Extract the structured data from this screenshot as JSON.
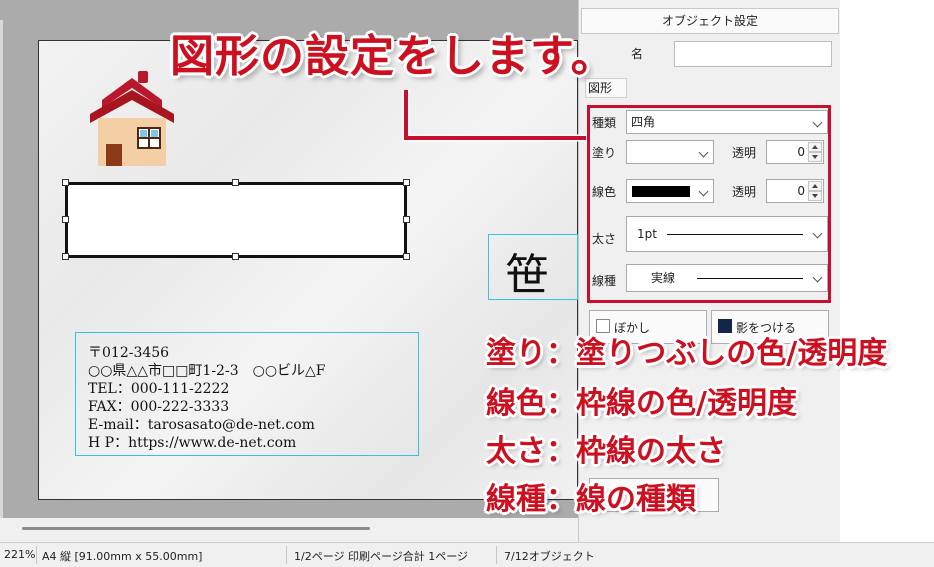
{
  "annotations": {
    "title": "図形の設定をします。",
    "lines": [
      "塗り：塗りつぶしの色/透明度",
      "線色：枠線の色/透明度",
      "太さ：枠線の太さ",
      "線種：線の種類"
    ],
    "color": "#cc1020"
  },
  "canvas": {
    "address_lines": [
      "〒012-3456",
      "○○県△△市□□町1-2-3　○○ビル△F",
      "TEL：000-111-2222",
      "FAX：000-222-3333",
      "E-mail：tarosasato@de-net.com",
      "H P：https://www.de-net.com"
    ],
    "name_char": "笹",
    "house_icon": "house-icon"
  },
  "panel": {
    "title": "オブジェクト設定",
    "name_label": "名",
    "name_value": "",
    "tab_label": "図形",
    "kind_label": "種類",
    "kind_value": "四角",
    "fill_label": "塗り",
    "fill_value": "",
    "fill_alpha_label": "透明",
    "fill_alpha_value": "0",
    "line_color_label": "線色",
    "line_color_hex": "#000000",
    "line_alpha_label": "透明",
    "line_alpha_value": "0",
    "width_label": "太さ",
    "width_value": "1pt",
    "type_label": "線種",
    "type_value": "実線",
    "btn_blur": "ぼかし",
    "btn_shadow": "影をつける"
  },
  "status": {
    "zoom": "221%",
    "paper": "A4 縦 [91.00mm x 55.00mm]",
    "pages": "1/2ページ 印刷ページ合計 1ページ",
    "objects": "7/12オブジェクト"
  }
}
